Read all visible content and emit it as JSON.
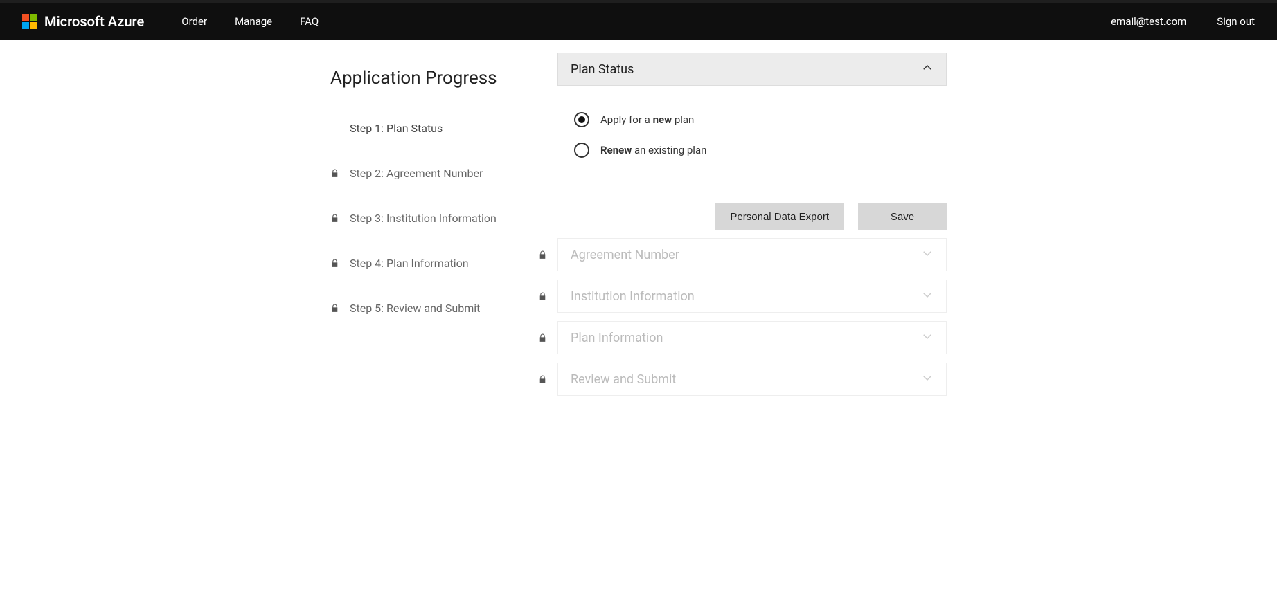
{
  "brand": {
    "name": "Microsoft Azure"
  },
  "nav": {
    "order": "Order",
    "manage": "Manage",
    "faq": "FAQ"
  },
  "user": {
    "email": "email@test.com",
    "signout": "Sign out"
  },
  "sidebar": {
    "title": "Application Progress",
    "steps": [
      {
        "label": "Step 1: Plan Status",
        "locked": false
      },
      {
        "label": "Step 2: Agreement Number",
        "locked": true
      },
      {
        "label": "Step 3: Institution Information",
        "locked": true
      },
      {
        "label": "Step 4: Plan Information",
        "locked": true
      },
      {
        "label": "Step 5: Review and Submit",
        "locked": true
      }
    ]
  },
  "panels": {
    "plan_status": {
      "title": "Plan Status",
      "open": true,
      "locked": false
    },
    "agreement": {
      "title": "Agreement Number",
      "open": false,
      "locked": true
    },
    "institution": {
      "title": "Institution Information",
      "open": false,
      "locked": true
    },
    "plan_info": {
      "title": "Plan Information",
      "open": false,
      "locked": true
    },
    "review": {
      "title": "Review and Submit",
      "open": false,
      "locked": true
    }
  },
  "plan_status_form": {
    "option_new": {
      "pre": "Apply for a ",
      "bold": "new",
      "post": " plan",
      "checked": true
    },
    "option_renew": {
      "pre": "",
      "bold": "Renew",
      "post": " an existing plan",
      "checked": false
    }
  },
  "buttons": {
    "export": "Personal Data Export",
    "save": "Save"
  }
}
